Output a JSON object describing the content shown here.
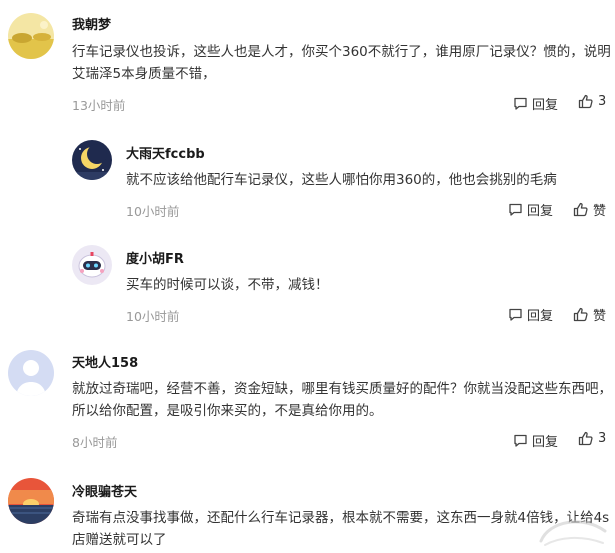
{
  "comments": [
    {
      "username": "我朝梦",
      "avatar_icon": "field-landscape-icon",
      "text": "行车记录仪也投诉，这些人也是人才，你买个360不就行了，谁用原厂记录仪？惯的，说明艾瑞泽5本身质量不错，",
      "time": "13小时前",
      "reply_label": "回复",
      "like_label": "3"
    },
    {
      "username": "大雨天fccbb",
      "avatar_icon": "moon-night-icon",
      "text": "就不应该给他配行车记录仪，这些人哪怕你用360的，他也会挑别的毛病",
      "time": "10小时前",
      "reply_label": "回复",
      "like_label": "赞"
    },
    {
      "username": "度小胡FR",
      "avatar_icon": "robot-mascot-icon",
      "text": "买车的时候可以谈，不带，减钱！",
      "time": "10小时前",
      "reply_label": "回复",
      "like_label": "赞"
    },
    {
      "username": "天地人158",
      "avatar_icon": "default-user-icon",
      "text": "就放过奇瑞吧，经营不善，资金短缺，哪里有钱买质量好的配件？你就当没配这些东西吧，所以给你配置，是吸引你来买的，不是真给你用的。",
      "time": "8小时前",
      "reply_label": "回复",
      "like_label": "3"
    },
    {
      "username": "冷眼骗苍天",
      "avatar_icon": "sunset-lake-icon",
      "text": "奇瑞有点没事找事做，还配什么行车记录器，根本就不需要，这东西一身就4倍钱，让给4s店赠送就可以了",
      "time": "",
      "reply_label": "",
      "like_label": ""
    }
  ]
}
